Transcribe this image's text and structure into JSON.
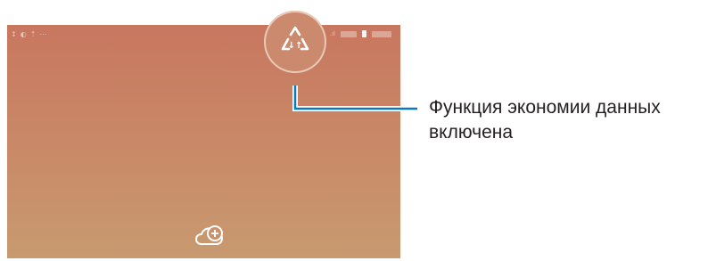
{
  "status_bar": {
    "left_icons": [
      "signal-icon",
      "data-icon",
      "upload-icon",
      "more-icon"
    ],
    "left_glyphs": [
      "↕",
      "◐",
      "⇡",
      "⋯"
    ],
    "signal_text": ".ıl"
  },
  "data_saver_icon": "data-saver-icon",
  "add_cloud_icon": "cloud-add-icon",
  "callout": {
    "line1": "Функция экономии данных",
    "line2": "включена"
  },
  "colors": {
    "callout_line": "#0a7abf",
    "screen_top": "#c8775f",
    "screen_bottom": "#c89a70",
    "text": "#231f20"
  }
}
